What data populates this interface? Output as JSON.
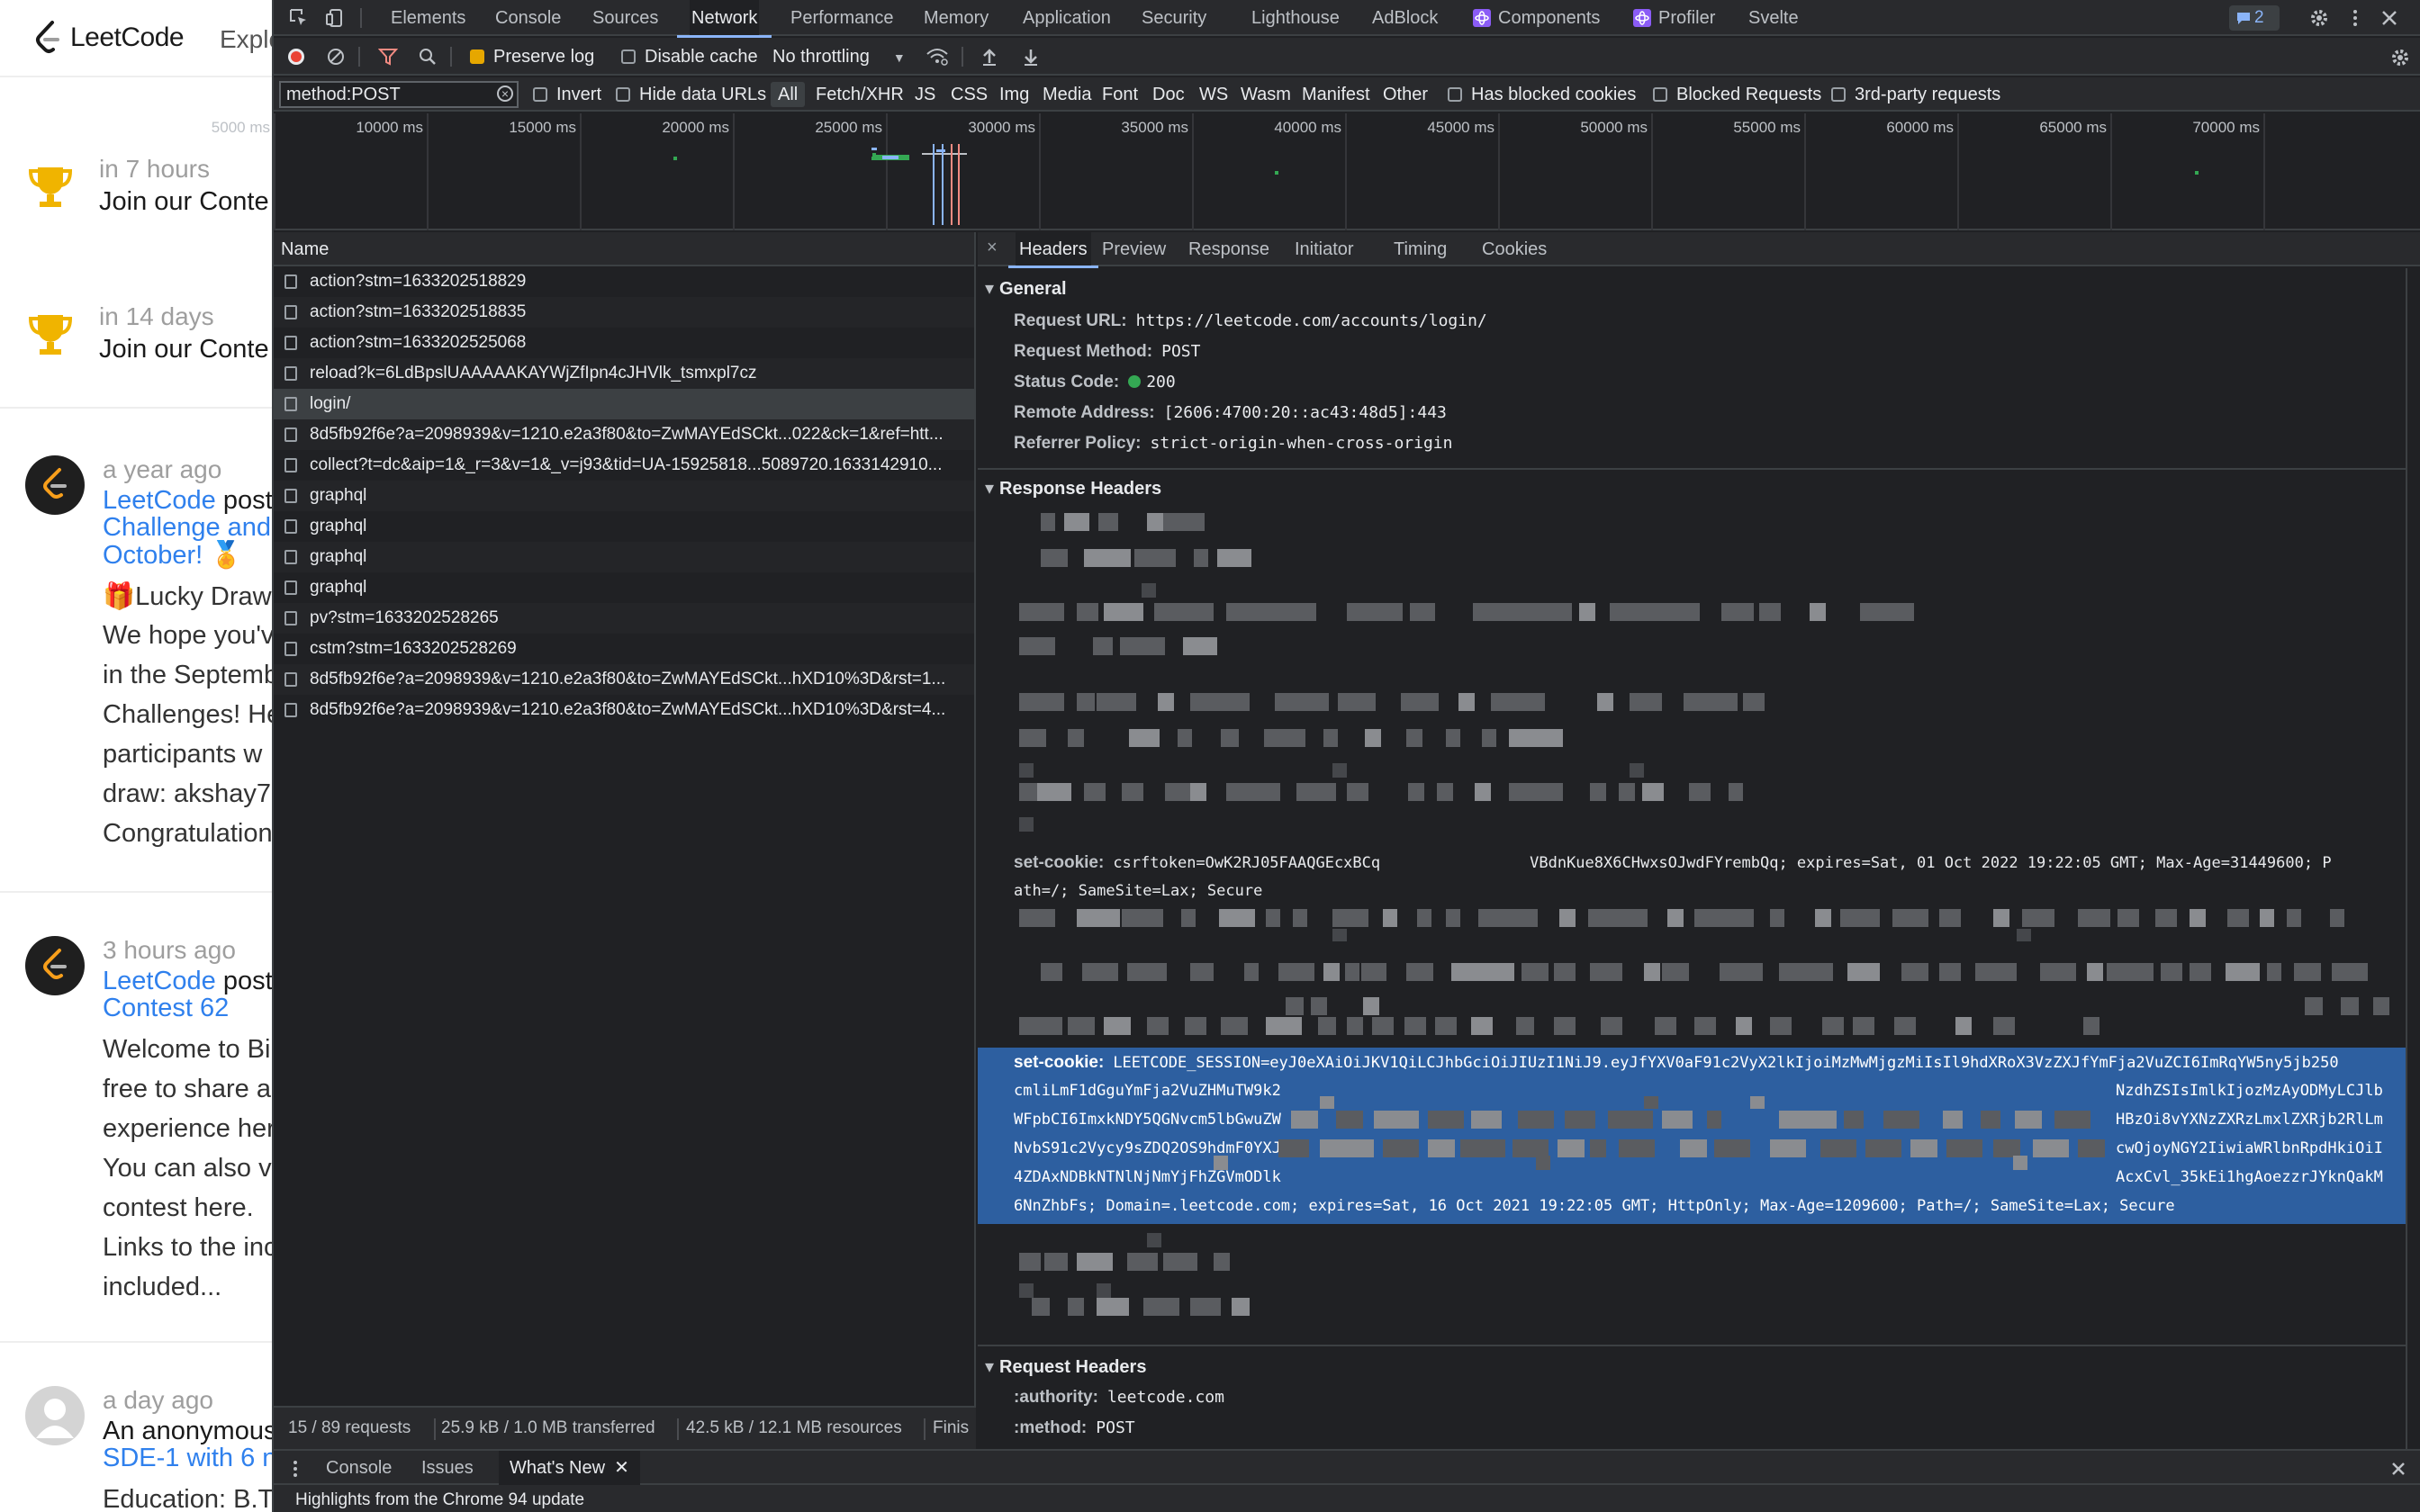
{
  "leetcode": {
    "logo_text": "LeetCode",
    "nav_explore": "Explo",
    "contests": [
      {
        "when": "in 7 hours",
        "title": "Join our Conte"
      },
      {
        "when": "in 14 days",
        "title": "Join our Conte"
      }
    ],
    "posts": [
      {
        "when": "a year ago",
        "line1_link": "LeetCode",
        "line1_rest": " post",
        "line2": "Challenge and",
        "line3": "October! 🏅",
        "body": [
          "🎁Lucky Draw",
          "We hope you'v",
          "in the Septemb",
          "Challenges! He",
          "participants w",
          "draw: akshay7",
          "Congratulation"
        ]
      },
      {
        "when": "3 hours ago",
        "line1_link": "LeetCode",
        "line1_rest": " post",
        "line2": "Contest 62",
        "body": [
          "Welcome to Bi",
          "free to share a",
          "experience her",
          "You can also v",
          "contest here.",
          "Links to the inc",
          "included..."
        ]
      },
      {
        "when": "a day ago",
        "line1_dark": "An anonymous",
        "line2": "SDE-1 with 6 n",
        "body": [
          "Education: B.T"
        ]
      }
    ]
  },
  "devtools": {
    "tabs": [
      "Elements",
      "Console",
      "Sources",
      "Network",
      "Performance",
      "Memory",
      "Application",
      "Security",
      "Lighthouse",
      "AdBlock",
      "Components",
      "Profiler",
      "Svelte"
    ],
    "active_tab": "Network",
    "issues_badge": "2",
    "toolbar": {
      "preserve_log": "Preserve log",
      "disable_cache": "Disable cache",
      "throttling": "No throttling"
    },
    "filter": {
      "value": "method:POST",
      "invert": "Invert",
      "hide_data_urls": "Hide data URLs",
      "types": [
        "All",
        "Fetch/XHR",
        "JS",
        "CSS",
        "Img",
        "Media",
        "Font",
        "Doc",
        "WS",
        "Wasm",
        "Manifest",
        "Other"
      ],
      "has_blocked_cookies": "Has blocked cookies",
      "blocked_requests": "Blocked Requests",
      "third_party": "3rd-party requests"
    },
    "timeline_ticks": [
      "5000 ms",
      "10000 ms",
      "15000 ms",
      "20000 ms",
      "25000 ms",
      "30000 ms",
      "35000 ms",
      "40000 ms",
      "45000 ms",
      "50000 ms",
      "55000 ms",
      "60000 ms",
      "65000 ms",
      "70000 ms"
    ],
    "request_list": {
      "header": "Name",
      "rows": [
        "action?stm=1633202518829",
        "action?stm=1633202518835",
        "action?stm=1633202525068",
        "reload?k=6LdBpslUAAAAAKAYWjZfIpn4cJHVlk_tsmxpl7cz",
        "login/",
        "8d5fb92f6e?a=2098939&v=1210.e2a3f80&to=ZwMAYEdSCkt...022&ck=1&ref=htt...",
        "collect?t=dc&aip=1&_r=3&v=1&_v=j93&tid=UA-15925818...5089720.1633142910...",
        "graphql",
        "graphql",
        "graphql",
        "graphql",
        "pv?stm=1633202528265",
        "cstm?stm=1633202528269",
        "8d5fb92f6e?a=2098939&v=1210.e2a3f80&to=ZwMAYEdSCkt...hXD10%3D&rst=1...",
        "8d5fb92f6e?a=2098939&v=1210.e2a3f80&to=ZwMAYEdSCkt...hXD10%3D&rst=4..."
      ],
      "selected_index": 4
    },
    "status": {
      "requests": "15 / 89 requests",
      "transferred": "25.9 kB / 1.0 MB transferred",
      "resources": "42.5 kB / 12.1 MB resources",
      "finish": "Finis"
    },
    "detail_tabs": [
      "Headers",
      "Preview",
      "Response",
      "Initiator",
      "Timing",
      "Cookies"
    ],
    "general": {
      "title": "General",
      "request_url_k": "Request URL:",
      "request_url_v": "https://leetcode.com/accounts/login/",
      "method_k": "Request Method:",
      "method_v": "POST",
      "status_k": "Status Code:",
      "status_v": "200",
      "remote_k": "Remote Address:",
      "remote_v": "[2606:4700:20::ac43:48d5]:443",
      "referrer_k": "Referrer Policy:",
      "referrer_v": "strict-origin-when-cross-origin"
    },
    "response_headers": {
      "title": "Response Headers",
      "csrf_k": "set-cookie:",
      "csrf_v1a": "csrftoken=OwK2RJ05FAAQGEcxBCq",
      "csrf_v1b": "VBdnKue8X6CHwxsOJwdFYrembQq; expires=Sat, 01 Oct 2022 19:22:05 GMT; Max-Age=31449600; P",
      "csrf_v2": "ath=/; SameSite=Lax; Secure",
      "session_k": "set-cookie:",
      "session_lines": [
        "LEETCODE_SESSION=eyJ0eXAiOiJKV1QiLCJhbGciOiJIUzI1NiJ9.eyJfYXV0aF91c2VyX2lkIjoiMzMwMjgzMiIsIl9hdXRoX3VzZXJfYmFja2VuZCI6ImRqYW5ny5jb250",
        "cmliLmF1dGguYmFja2VuZHMuTW9k2",
        "WFpbCI6ImxkNDY5QGNvcm5lbGwuZW",
        "NvbS91c2Vycy9sZDQ2OS9hdmF0YXJ",
        "4ZDAxNDBkNTNlNjNmYjFhZGVmODlk",
        "6NnZhbFs; Domain=.leetcode.com; expires=Sat, 16 Oct 2021 19:22:05 GMT; HttpOnly; Max-Age=1209600; Path=/; SameSite=Lax; Secure"
      ],
      "session_right": [
        "NzdhZSIsImlkIjozMzAyODMyLCJlb",
        "HBzOi8vYXNzZXRzLmxlZXRjb2RlLm",
        "cwOjoyNGY2IiwiaWRlbnRpdHkiOiI",
        "AcxCvl_35kEi1hgAoezzrJYknQakM"
      ]
    },
    "request_headers": {
      "title": "Request Headers",
      "authority_k": ":authority:",
      "authority_v": "leetcode.com",
      "method_k": ":method:",
      "method_v": "POST"
    },
    "drawer": {
      "tabs": [
        "Console",
        "Issues",
        "What's New"
      ],
      "active": "What's New",
      "body": "Highlights from the Chrome 94 update"
    }
  }
}
